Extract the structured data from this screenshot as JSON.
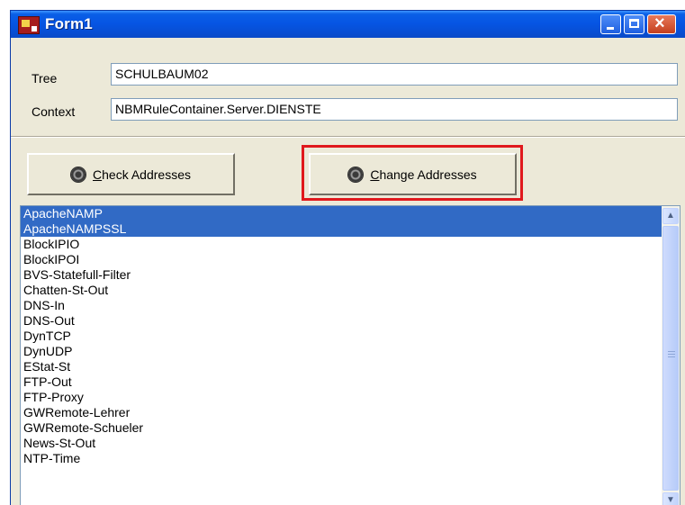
{
  "window": {
    "title": "Form1"
  },
  "fields": {
    "tree_label": "Tree",
    "tree_value": "SCHULBAUM02",
    "context_label": "Context",
    "context_value": "NBMRuleContainer.Server.DIENSTE"
  },
  "buttons": {
    "check_label": "Check Addresses",
    "change_label": "Change Addresses"
  },
  "list": {
    "items": [
      "ApacheNAMP",
      "ApacheNAMPSSL",
      "BlockIPIO",
      "BlockIPOI",
      "BVS-Statefull-Filter",
      "Chatten-St-Out",
      "DNS-In",
      "DNS-Out",
      "DynTCP",
      "DynUDP",
      "EStat-St",
      "FTP-Out",
      "FTP-Proxy",
      "GWRemote-Lehrer",
      "GWRemote-Schueler",
      "News-St-Out",
      "NTP-Time"
    ],
    "selected": [
      0,
      1
    ]
  },
  "colors": {
    "highlight_box": "#e0191d",
    "selection": "#316ac5",
    "titlebar": "#0655e4"
  }
}
